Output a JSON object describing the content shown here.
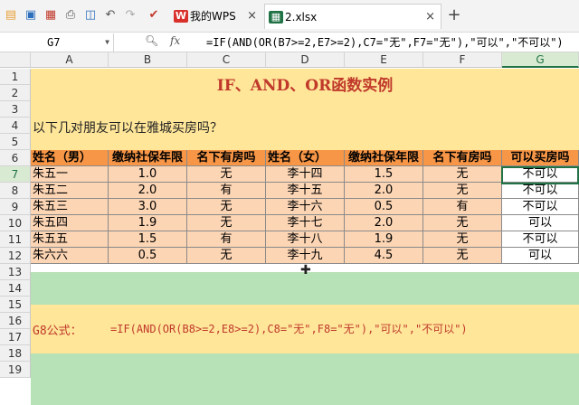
{
  "tabs": {
    "wps_label": "我的WPS",
    "wps_logo": "W",
    "file_label": "2.xlsx",
    "close": "×",
    "new_tab": "+"
  },
  "formula_bar": {
    "cell_ref": "G7",
    "fx": "fx",
    "formula": "=IF(AND(OR(B7>=2,E7>=2),C7=\"无\",F7=\"无\"),\"可以\",\"不可以\")"
  },
  "columns": [
    "A",
    "B",
    "C",
    "D",
    "E",
    "F",
    "G"
  ],
  "rows": [
    "1",
    "2",
    "3",
    "4",
    "5",
    "6",
    "7",
    "8",
    "9",
    "10",
    "11",
    "12",
    "13",
    "14",
    "15",
    "16",
    "17",
    "18",
    "19"
  ],
  "sheet": {
    "title": "IF、AND、OR函数实例",
    "question": "以下几对朋友可以在雅城买房吗？",
    "headers": [
      "姓名（男）",
      "缴纳社保年限",
      "名下有房吗",
      "姓名（女）",
      "缴纳社保年限",
      "名下有房吗",
      "可以买房吗"
    ],
    "table": [
      [
        "朱五一",
        "1.0",
        "无",
        "李十四",
        "1.5",
        "无",
        "不可以"
      ],
      [
        "朱五二",
        "2.0",
        "有",
        "李十五",
        "2.0",
        "无",
        "不可以"
      ],
      [
        "朱五三",
        "3.0",
        "无",
        "李十六",
        "0.5",
        "有",
        "不可以"
      ],
      [
        "朱五四",
        "1.9",
        "无",
        "李十七",
        "2.0",
        "无",
        "可以"
      ],
      [
        "朱五五",
        "1.5",
        "有",
        "李十八",
        "1.9",
        "无",
        "不可以"
      ],
      [
        "朱六六",
        "0.5",
        "无",
        "李十九",
        "4.5",
        "无",
        "可以"
      ]
    ],
    "g8_label": "G8公式：",
    "g8_formula": "=IF(AND(OR(B8>=2,E8>=2),C8=\"无\",F8=\"无\"),\"可以\",\"不可以\")"
  },
  "colors": {
    "title_band": "#ffe699",
    "green_band": "#b7e1b7",
    "header": "#f79646",
    "body": "#fcd5b4",
    "accent": "#c0392b"
  }
}
